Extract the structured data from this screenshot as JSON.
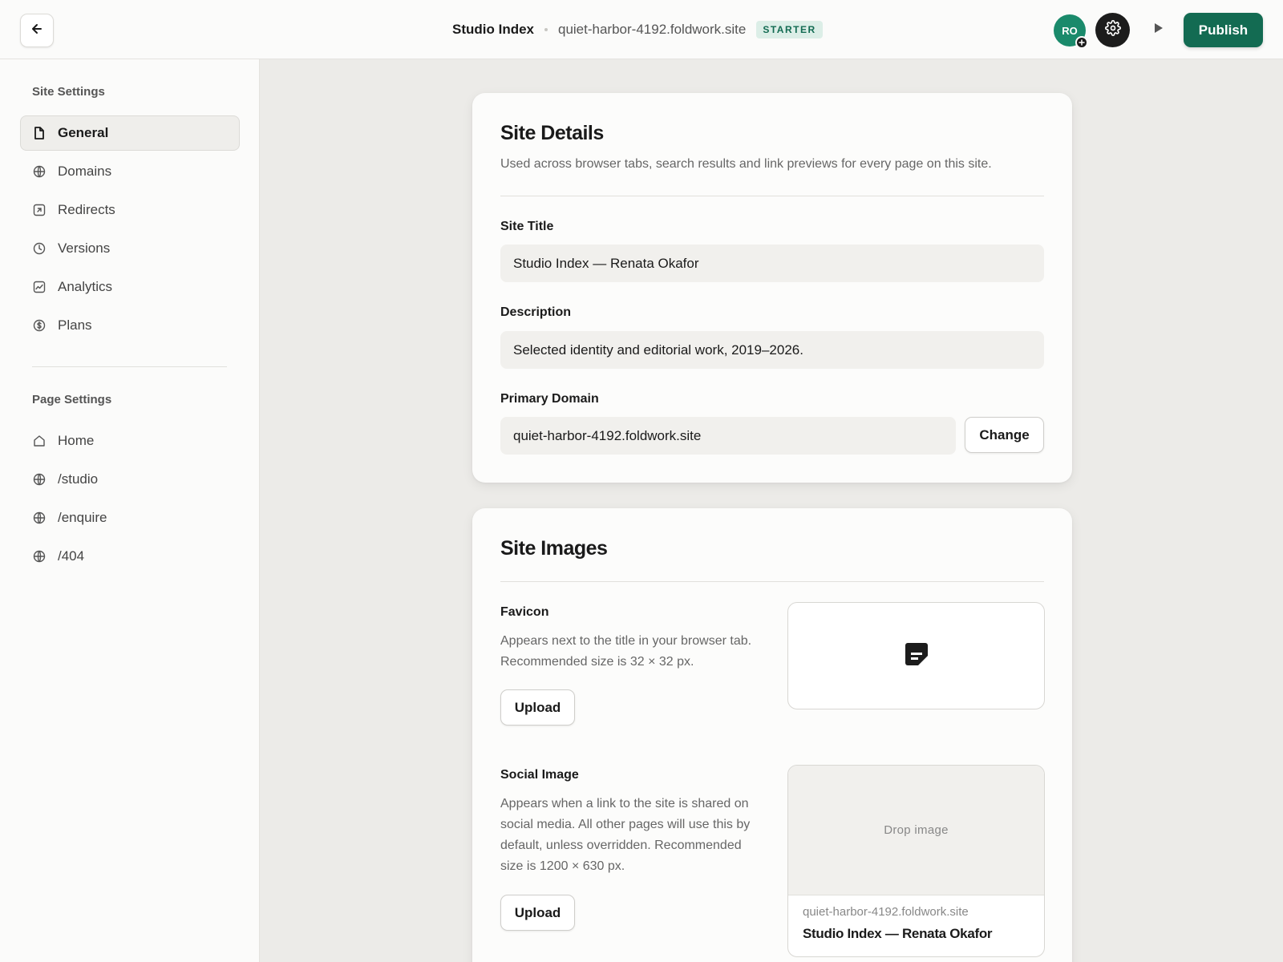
{
  "topbar": {
    "site_name": "Studio Index",
    "site_domain": "quiet-harbor-4192.foldwork.site",
    "plan_badge": "STARTER",
    "avatar_initials": "RO",
    "publish_label": "Publish"
  },
  "sidebar": {
    "site_heading": "Site Settings",
    "site_items": [
      {
        "label": "General",
        "icon": "document-icon",
        "active": true
      },
      {
        "label": "Domains",
        "icon": "globe-icon"
      },
      {
        "label": "Redirects",
        "icon": "redirect-icon"
      },
      {
        "label": "Versions",
        "icon": "clock-icon"
      },
      {
        "label": "Analytics",
        "icon": "chart-icon"
      },
      {
        "label": "Plans",
        "icon": "dollar-icon"
      }
    ],
    "page_heading": "Page Settings",
    "page_items": [
      {
        "label": "Home",
        "icon": "home-icon"
      },
      {
        "label": "/studio",
        "icon": "globe-icon"
      },
      {
        "label": "/enquire",
        "icon": "globe-icon"
      },
      {
        "label": "/404",
        "icon": "globe-icon"
      }
    ]
  },
  "site_details": {
    "title": "Site Details",
    "subtitle": "Used across browser tabs, search results and link previews for every page on this site.",
    "site_title_label": "Site Title",
    "site_title_value": "Studio Index — Renata Okafor",
    "description_label": "Description",
    "description_value": "Selected identity and editorial work, 2019–2026.",
    "domain_label": "Primary Domain",
    "domain_value": "quiet-harbor-4192.foldwork.site",
    "change_label": "Change"
  },
  "site_images": {
    "title": "Site Images",
    "favicon_label": "Favicon",
    "favicon_help": "Appears next to the title in your browser tab. Recommended size is 32 × 32 px.",
    "favicon_upload_label": "Upload",
    "social_label": "Social Image",
    "social_help": "Appears when a link to the site is shared on social media. All other pages will use this by default, unless overridden. Recommended size is 1200 × 630 px.",
    "social_upload_label": "Upload",
    "drop_label": "Drop image",
    "preview_url": "quiet-harbor-4192.foldwork.site",
    "preview_title": "Studio Index — Renata Okafor"
  },
  "colors": {
    "accent": "#136b52",
    "avatar": "#1a8a6b",
    "badge_bg": "#dceee7"
  }
}
